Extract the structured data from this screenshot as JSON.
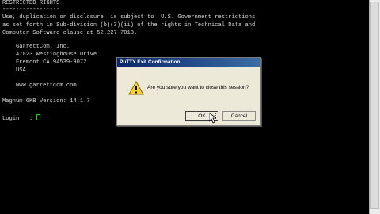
{
  "terminal": {
    "lines": [
      "RESTRICTED RIGHTS",
      "-----------------",
      "Use, duplication or disclosure  is subject to  U.S. Government restrictions",
      "as set forth in Sub-division (b)(3)(ii) of the rights in Technical Data and",
      "Computer Software clause at 52.227-7013.",
      "",
      "    GarrettCom, Inc.",
      "    47823 Westinghouse Drive",
      "    Fremont CA 94539-9072",
      "    USA",
      "",
      "    www.garrettcom.com",
      "",
      "Magnum 6KB Version: 14.1.7",
      "",
      "Login   : "
    ],
    "text_color": "#d8d8d8",
    "background": "#000000",
    "cursor_color": "#19d019"
  },
  "dialog": {
    "title": "PuTTY Exit Confirmation",
    "message": "Are you sure you want to close this session?",
    "icon": "warning-icon",
    "ok_label": "OK",
    "cancel_label": "Cancel"
  }
}
